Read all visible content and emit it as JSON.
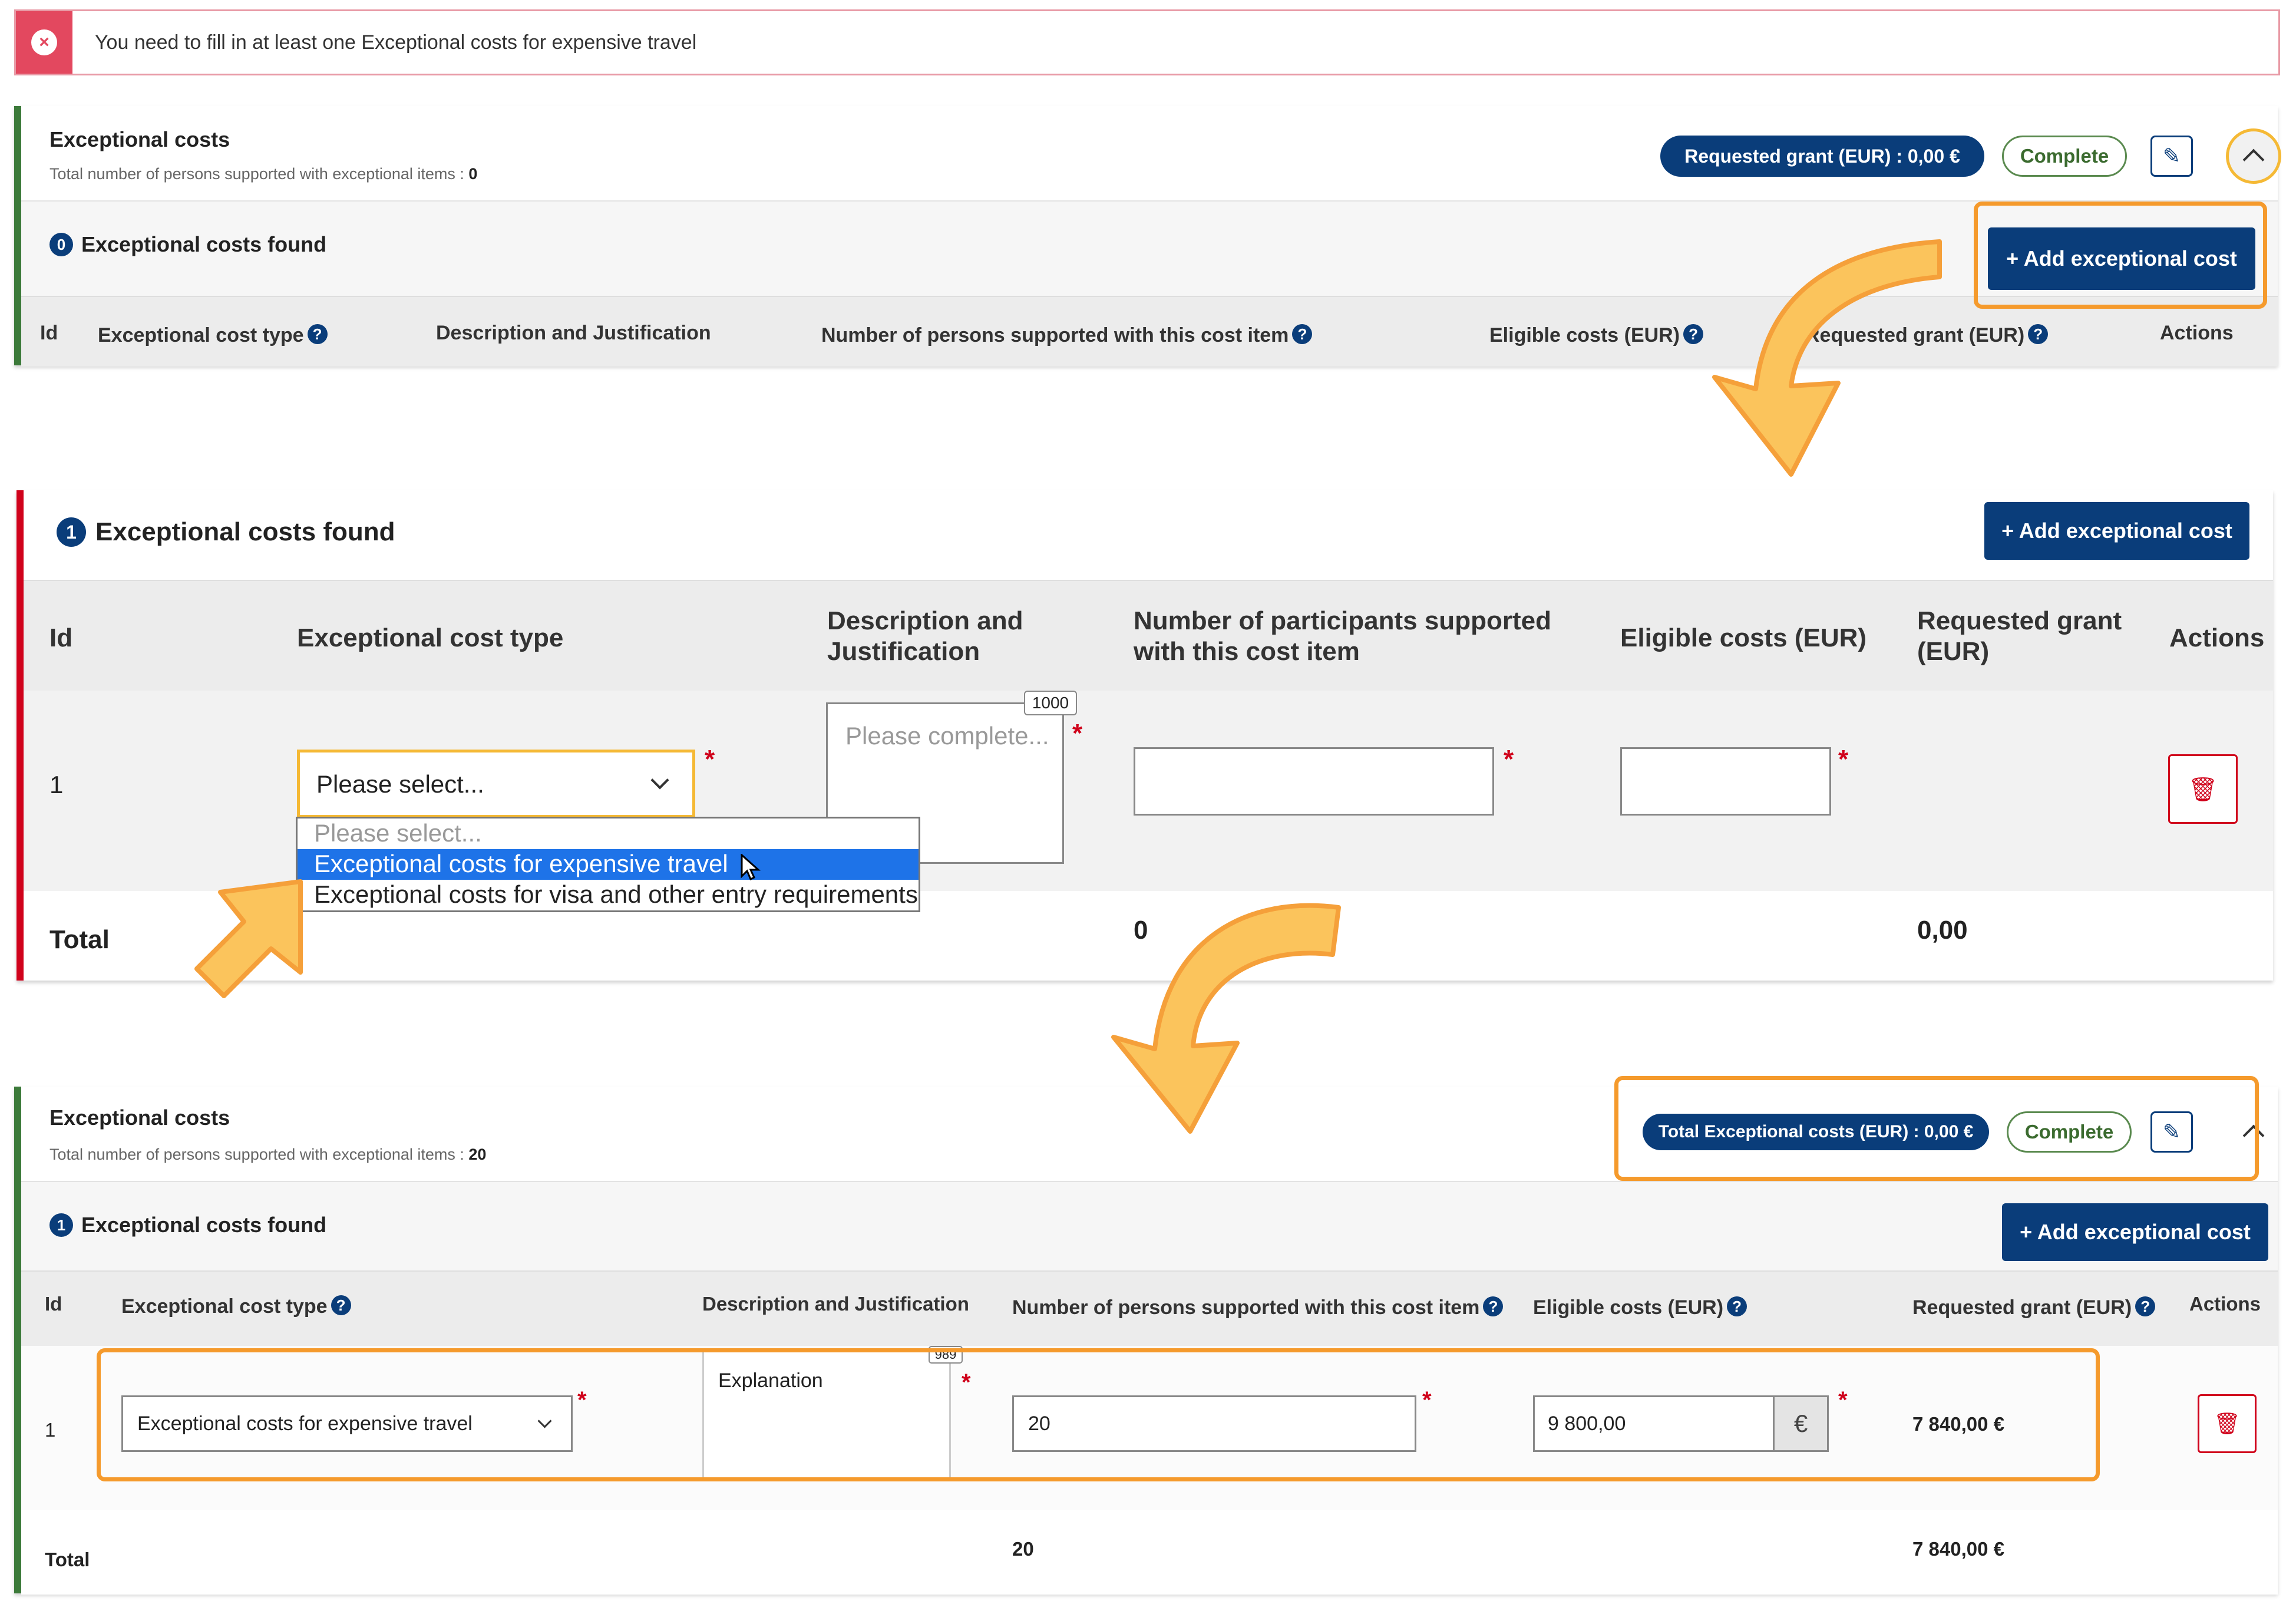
{
  "alert": {
    "message": "You need to fill in at least one Exceptional costs for expensive travel"
  },
  "panel1": {
    "title": "Exceptional costs",
    "subtitle": "Total number of persons supported with exceptional items : ",
    "subtitle_value": "0",
    "requested_grant_pill": "Requested grant (EUR) : 0,00 €",
    "status": "Complete",
    "found_count": "0",
    "found_label": "Exceptional costs found",
    "add_button": "+ Add exceptional cost",
    "columns": [
      "Id",
      "Exceptional cost type",
      "Description and Justification",
      "Number of persons supported with this cost item",
      "Eligible costs (EUR)",
      "Requested grant (EUR)",
      "Actions"
    ]
  },
  "panel2": {
    "found_count": "1",
    "found_label": "Exceptional costs found",
    "add_button": "+ Add exceptional cost",
    "columns": [
      "Id",
      "Exceptional cost type",
      "Description and Justification",
      "Number of participants supported with this cost item",
      "Eligible costs (EUR)",
      "Requested grant (EUR)",
      "Actions"
    ],
    "row": {
      "id": "1",
      "type_placeholder": "Please select...",
      "desc_placeholder": "Please complete...",
      "char_limit": "1000"
    },
    "dropdown_options": [
      "Please select...",
      "Exceptional costs for expensive travel",
      "Exceptional costs for visa and other entry requirements"
    ],
    "dropdown_selected_index": 1,
    "total_label": "Total",
    "total_persons": "0",
    "total_grant": "0,00"
  },
  "panel3": {
    "title": "Exceptional costs",
    "subtitle": "Total number of persons supported with exceptional items : ",
    "subtitle_value": "20",
    "total_pill": "Total Exceptional costs (EUR) : 0,00 €",
    "status": "Complete",
    "found_count": "1",
    "found_label": "Exceptional costs found",
    "add_button": "+ Add exceptional cost",
    "columns": [
      "Id",
      "Exceptional cost type",
      "Description and Justification",
      "Number of persons supported with this cost item",
      "Eligible costs (EUR)",
      "Requested grant (EUR)",
      "Actions"
    ],
    "row": {
      "id": "1",
      "type": "Exceptional costs for expensive travel",
      "description": "Explanation",
      "char_remaining": "989",
      "persons": "20",
      "eligible": "9 800,00",
      "currency": "€",
      "grant": "7 840,00 €"
    },
    "total_label": "Total",
    "total_persons": "20",
    "total_grant": "7 840,00 €"
  },
  "colors": {
    "accent": "#0a3d7a",
    "highlight": "#f59a2c",
    "error": "#d0021b",
    "success": "#5a8a4f"
  }
}
